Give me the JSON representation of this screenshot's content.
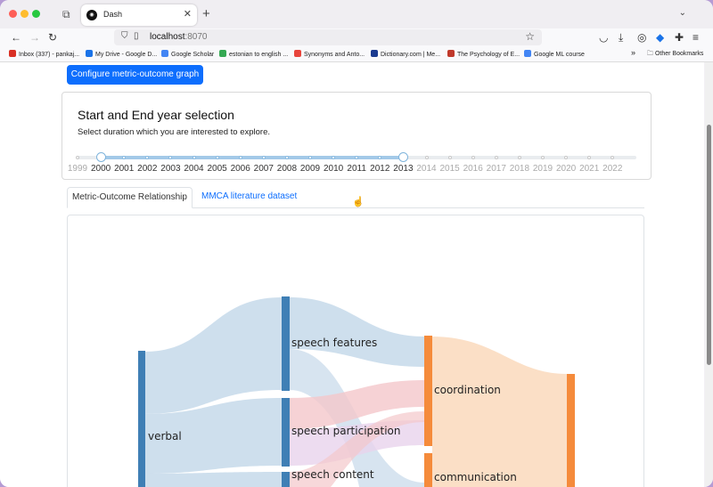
{
  "browser": {
    "tab_title": "Dash",
    "url_host": "localhost",
    "url_port": ":8070",
    "bookmarks": [
      {
        "label": "Inbox (337) - pankaj...",
        "color": "#d93025"
      },
      {
        "label": "My Drive - Google D...",
        "color": "#1a73e8"
      },
      {
        "label": "Google Scholar",
        "color": "#4285f4"
      },
      {
        "label": "estonian to english ...",
        "color": "#34a853"
      },
      {
        "label": "Synonyms and Anto...",
        "color": "#e8453c"
      },
      {
        "label": "Dictionary.com | Me...",
        "color": "#1a3a8f"
      },
      {
        "label": "The Psychology of E...",
        "color": "#c0392b"
      },
      {
        "label": "Google ML course",
        "color": "#4285f4"
      }
    ],
    "other_bookmarks": "Other Bookmarks"
  },
  "page": {
    "config_button": "Configure metric-outcome graph",
    "card_title": "Start and End year selection",
    "card_subtitle": "Select duration which you are interested to explore.",
    "years": [
      "1999",
      "2000",
      "2001",
      "2002",
      "2003",
      "2004",
      "2005",
      "2006",
      "2007",
      "2008",
      "2009",
      "2010",
      "2011",
      "2012",
      "2013",
      "2014",
      "2015",
      "2016",
      "2017",
      "2018",
      "2019",
      "2020",
      "2021",
      "2022"
    ],
    "range_start": "2000",
    "range_end": "2013",
    "tabs": {
      "active": "Metric-Outcome Relationship",
      "other": "MMCA literature dataset"
    }
  },
  "chart_data": {
    "type": "sankey",
    "nodes": [
      "verbal",
      "speech features",
      "speech participation",
      "speech content",
      "coordination",
      "communication"
    ],
    "colors": {
      "metric": "#3f7fb5",
      "outcome": "#f58b3b",
      "link_blue": "#c6d9ea",
      "link_orange": "#fbdcc0"
    }
  }
}
